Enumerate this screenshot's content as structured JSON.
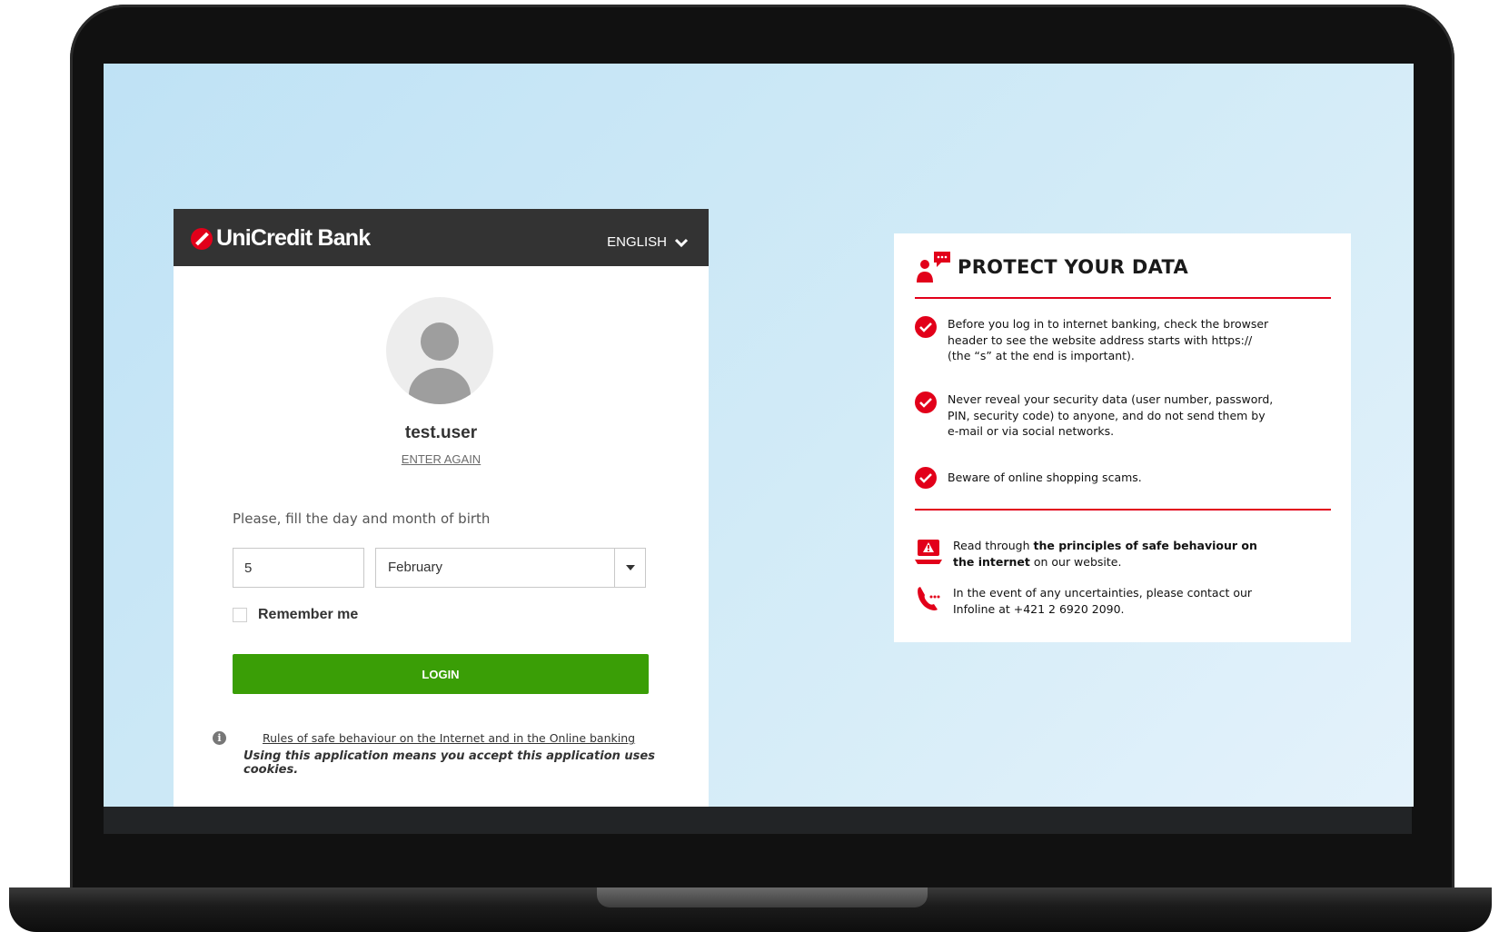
{
  "brand": {
    "name": "UniCredit Bank",
    "accent_color": "#e2001a",
    "button_color": "#3a9e06"
  },
  "header": {
    "language": "ENGLISH"
  },
  "login": {
    "username": "test.user",
    "enter_again": "ENTER AGAIN",
    "prompt": "Please, fill the day and month of birth",
    "day_value": "5",
    "month_value": "February",
    "remember_label": "Remember me",
    "remember_checked": false,
    "login_button": "LOGIN",
    "rules_link": "Rules of safe behaviour on the Internet and in the Online banking",
    "cookies_notice": "Using this application means you accept this application uses cookies."
  },
  "protect": {
    "title": "PROTECT YOUR DATA",
    "tips": [
      "Before you log in to internet banking, check the browser header to see the website address starts with https:// (the “s” at the end is important).",
      "Never reveal your security data (user number, password, PIN, security code) to anyone, and do not send them by e-mail or via social networks.",
      "Beware of online shopping scams."
    ],
    "read_prefix": "Read through ",
    "read_bold": "the principles of safe behaviour on the internet",
    "read_suffix": " on our website.",
    "contact": "In the event of any uncertainties, please contact our Infoline at +421 2 6920 2090."
  }
}
